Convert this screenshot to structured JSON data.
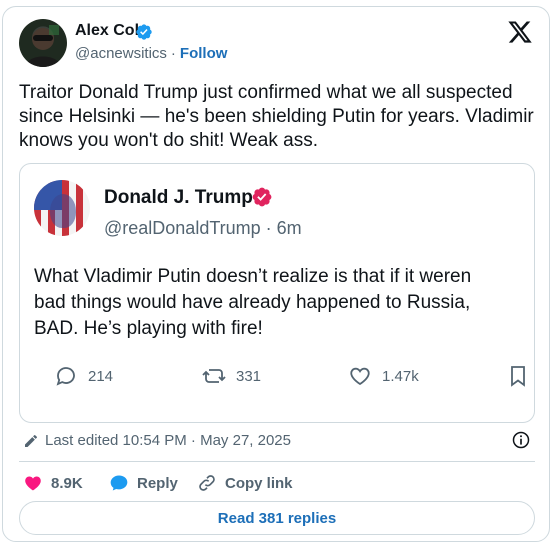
{
  "author": {
    "name": "Alex Cole",
    "handle": "@acnewsitics",
    "separator": "·",
    "follow_label": "Follow"
  },
  "tweet": {
    "text": "Traitor Donald Trump just confirmed what we all suspected since Helsinki — he's been shielding Putin for years. Vladimir knows you won't do shit! Weak ass."
  },
  "quoted": {
    "name": "Donald J. Trump",
    "handle_time": "@realDonaldTrump · 6m",
    "lines": [
      "What Vladimir Putin doesn’t realize is that if it weren",
      "bad things would have already happened to Russia,",
      "BAD. He’s playing with fire!"
    ],
    "replies": "214",
    "reposts": "331",
    "likes": "1.47k"
  },
  "footer": {
    "edited": "Last edited 10:54 PM · May 27, 2025",
    "likes": "8.9K",
    "reply_label": "Reply",
    "copy_label": "Copy link",
    "read_replies": "Read 381 replies"
  },
  "colors": {
    "verified": "#1d9bf0",
    "quoted_verified": "#e0245e",
    "like": "#f91880",
    "link": "#1d6fb8"
  },
  "icons": [
    "verified-badge-icon",
    "x-logo-icon",
    "reply-icon",
    "repost-icon",
    "like-icon",
    "bookmark-icon",
    "pencil-icon",
    "info-icon",
    "heart-icon",
    "chat-bubble-icon",
    "link-icon"
  ]
}
